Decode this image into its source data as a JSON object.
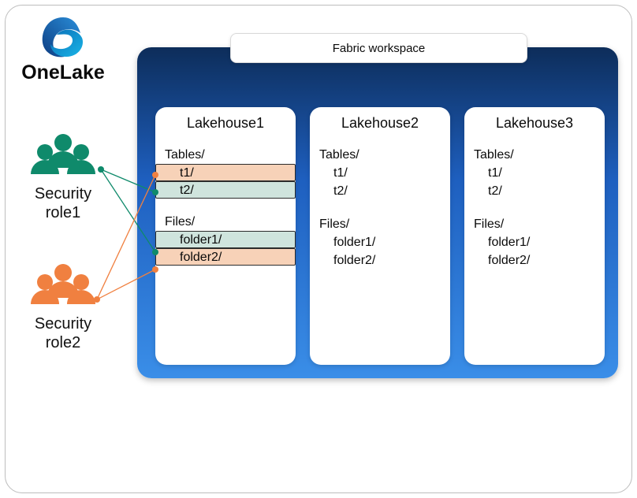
{
  "product": {
    "name": "OneLake"
  },
  "roles": {
    "role1": {
      "label_line1": "Security",
      "label_line2": "role1",
      "color": "#0f8a6b"
    },
    "role2": {
      "label_line1": "Security",
      "label_line2": "role2",
      "color": "#f08040"
    }
  },
  "workspace": {
    "label": "Fabric workspace",
    "lakehouses": [
      {
        "name": "Lakehouse1",
        "tables_label": "Tables/",
        "tables": [
          {
            "name": "t1/",
            "highlight": "orange"
          },
          {
            "name": "t2/",
            "highlight": "teal"
          }
        ],
        "files_label": "Files/",
        "files": [
          {
            "name": "folder1/",
            "highlight": "teal"
          },
          {
            "name": "folder2/",
            "highlight": "orange"
          }
        ]
      },
      {
        "name": "Lakehouse2",
        "tables_label": "Tables/",
        "tables": [
          {
            "name": "t1/"
          },
          {
            "name": "t2/"
          }
        ],
        "files_label": "Files/",
        "files": [
          {
            "name": "folder1/"
          },
          {
            "name": "folder2/"
          }
        ]
      },
      {
        "name": "Lakehouse3",
        "tables_label": "Tables/",
        "tables": [
          {
            "name": "t1/"
          },
          {
            "name": "t2/"
          }
        ],
        "files_label": "Files/",
        "files": [
          {
            "name": "folder1/"
          },
          {
            "name": "folder2/"
          }
        ]
      }
    ]
  },
  "connections": [
    {
      "from": "role1",
      "to": "lakehouse1.t2",
      "color": "#0f8a6b"
    },
    {
      "from": "role1",
      "to": "lakehouse1.folder1",
      "color": "#0f8a6b"
    },
    {
      "from": "role2",
      "to": "lakehouse1.t1",
      "color": "#f08040"
    },
    {
      "from": "role2",
      "to": "lakehouse1.folder2",
      "color": "#f08040"
    }
  ]
}
